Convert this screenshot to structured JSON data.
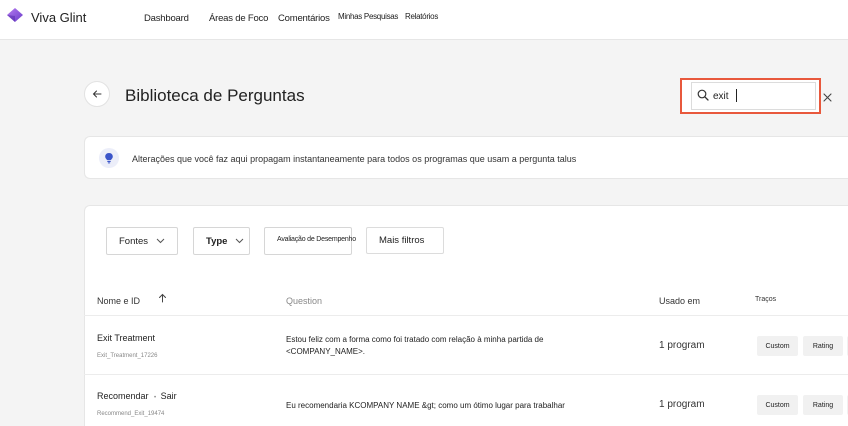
{
  "app": {
    "brand": "Viva Glint",
    "nav": {
      "dashboard": "Dashboard",
      "focus_areas": "Áreas de Foco",
      "comments": "Comentários",
      "my_surveys": "Minhas Pesquisas",
      "reports": "Relatórios"
    },
    "colors": {
      "brand_purple": "#8b4fd8",
      "highlight": "#e8583c"
    }
  },
  "page": {
    "title": "Biblioteca de Perguntas",
    "back_icon": "arrow-left-icon"
  },
  "search": {
    "value": "exit",
    "icon": "search-icon",
    "clear_icon": "close-icon"
  },
  "info": {
    "icon": "lightbulb-icon",
    "text": "Alterações que você faz aqui propagam instantaneamente para todos os programas que usam a pergunta talus"
  },
  "filters": {
    "fontes": "Fontes",
    "type": "Type",
    "avaliacao": "Avaliação de Desempenho",
    "mais": "Mais filtros"
  },
  "table": {
    "headers": {
      "name": "Nome e ID",
      "question": "Question",
      "used": "Usado em",
      "traits": "Traços"
    },
    "rows": [
      {
        "name": "Exit Treatment",
        "id": "Exit_Treatment_17226",
        "question_line1": "Estou feliz com a forma como foi tratado com relação à minha partida de",
        "question_line2": "<COMPANY_NAME>.",
        "used": "1 program",
        "tag1": "Custom",
        "tag2": "Rating"
      },
      {
        "name": "Recomendar",
        "name_suffix": "Sair",
        "id": "Recommend_Exit_19474",
        "question_line1": "Eu recomendaria KCOMPANY NAME &gt; como um ótimo lugar para trabalhar",
        "used": "1 program",
        "tag1": "Custom",
        "tag2": "Rating"
      }
    ]
  }
}
